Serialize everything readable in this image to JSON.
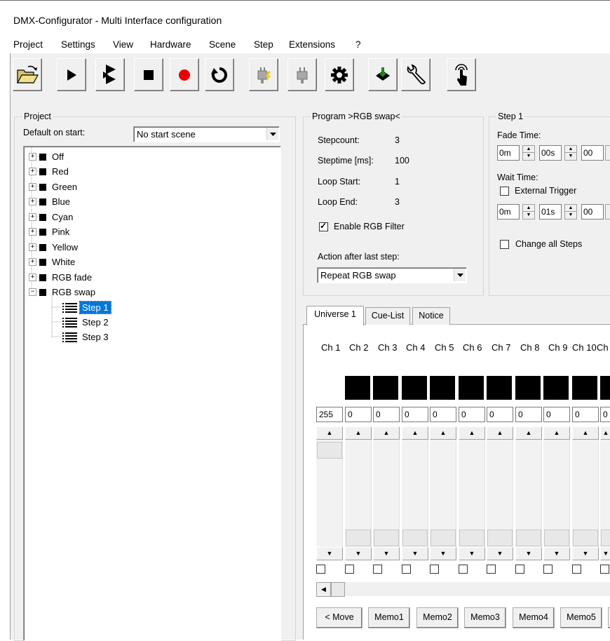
{
  "window": {
    "title": "DMX-Configurator - Multi Interface configuration"
  },
  "menu": [
    "Project",
    "Settings",
    "View",
    "Hardware",
    "Scene",
    "Step",
    "Extensions",
    "?"
  ],
  "toolbar": {
    "buttons": [
      "open-folder",
      "play",
      "step-forward",
      "stop",
      "record",
      "reset",
      "plug-disconnected",
      "plug",
      "settings",
      "download",
      "wrench-tool",
      "touch"
    ]
  },
  "project": {
    "group_label": "Project",
    "default_label": "Default on start:",
    "default_value": "No start scene",
    "scenes": [
      "Off",
      "Red",
      "Green",
      "Blue",
      "Cyan",
      "Pink",
      "Yellow",
      "White",
      "RGB fade",
      "RGB swap"
    ],
    "steps": [
      "Step 1",
      "Step 2",
      "Step 3"
    ],
    "selected_step": "Step 1"
  },
  "program": {
    "group_label": "Program >RGB swap<",
    "stepcount_label": "Stepcount:",
    "stepcount_value": "3",
    "steptime_label": "Steptime [ms]:",
    "steptime_value": "100",
    "loopstart_label": "Loop Start:",
    "loopstart_value": "1",
    "loopend_label": "Loop End:",
    "loopend_value": "3",
    "rgbfilter_label": "Enable RGB Filter",
    "rgbfilter_checked": true,
    "action_label": "Action after last step:",
    "action_value": "Repeat RGB swap"
  },
  "step": {
    "group_label": "Step 1",
    "fade_label": "Fade Time:",
    "fade_min": "0m",
    "fade_sec": "00s",
    "fade_ms": "00",
    "wait_label": "Wait Time:",
    "ext_trigger_label": "External Trigger",
    "wait_min": "0m",
    "wait_sec": "01s",
    "wait_ms": "00",
    "change_all_label": "Change all Steps"
  },
  "tabs": [
    "Universe 1",
    "Cue-List",
    "Notice"
  ],
  "channels": {
    "labels": [
      "Ch 1",
      "Ch 2",
      "Ch 3",
      "Ch 4",
      "Ch 5",
      "Ch 6",
      "Ch 7",
      "Ch 8",
      "Ch 9",
      "Ch 10",
      "Ch"
    ],
    "values": [
      "255",
      "0",
      "0",
      "0",
      "0",
      "0",
      "0",
      "0",
      "0",
      "0",
      "0"
    ]
  },
  "memo_buttons": [
    "< Move",
    "Memo1",
    "Memo2",
    "Memo3",
    "Memo4",
    "Memo5"
  ]
}
